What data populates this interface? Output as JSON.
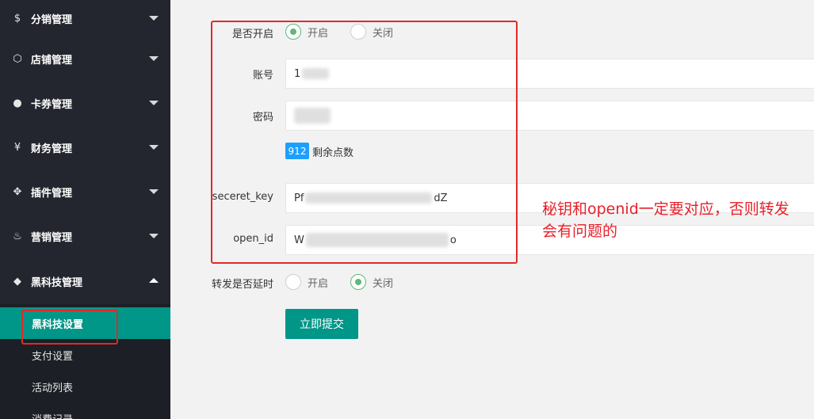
{
  "sidebar": {
    "items": [
      {
        "icon": "dollar-icon",
        "glyph": "$",
        "label": "分销管理",
        "expanded": false
      },
      {
        "icon": "cube-icon",
        "glyph": "⬡",
        "label": "店铺管理",
        "expanded": false
      },
      {
        "icon": "coupon-icon",
        "glyph": "●",
        "label": "卡券管理",
        "expanded": false
      },
      {
        "icon": "yen-icon",
        "glyph": "¥",
        "label": "财务管理",
        "expanded": false
      },
      {
        "icon": "plugin-icon",
        "glyph": "✥",
        "label": "插件管理",
        "expanded": false
      },
      {
        "icon": "fire-icon",
        "glyph": "♨",
        "label": "营销管理",
        "expanded": false
      },
      {
        "icon": "diamond-icon",
        "glyph": "◆",
        "label": "黑科技管理",
        "expanded": true
      }
    ],
    "submenu": [
      {
        "label": "黑科技设置",
        "active": true
      },
      {
        "label": "支付设置",
        "active": false
      },
      {
        "label": "活动列表",
        "active": false
      },
      {
        "label": "消费记录",
        "active": false
      }
    ]
  },
  "form": {
    "enabled": {
      "label": "是否开启",
      "options": [
        "开启",
        "关闭"
      ],
      "selected": "开启"
    },
    "account": {
      "label": "账号",
      "value": "1"
    },
    "password": {
      "label": "密码",
      "value": ""
    },
    "points": {
      "count": "912",
      "label": "剩余点数"
    },
    "secret_key": {
      "label": "seceret_key",
      "prefix": "Pf",
      "suffix": "dZ"
    },
    "open_id": {
      "label": "open_id",
      "prefix": "W",
      "suffix": "o"
    },
    "delay": {
      "label": "转发是否延时",
      "options": [
        "开启",
        "关闭"
      ],
      "selected": "关闭"
    },
    "submit_label": "立即提交"
  },
  "annotation": {
    "text": "秘钥和openid一定要对应，否则转发会有问题的"
  },
  "colors": {
    "sidebar_bg": "#23262e",
    "active_green": "#009688",
    "radio_green": "#5fb878",
    "badge_blue": "#1e9fff",
    "annotation_red": "#e8202a"
  }
}
